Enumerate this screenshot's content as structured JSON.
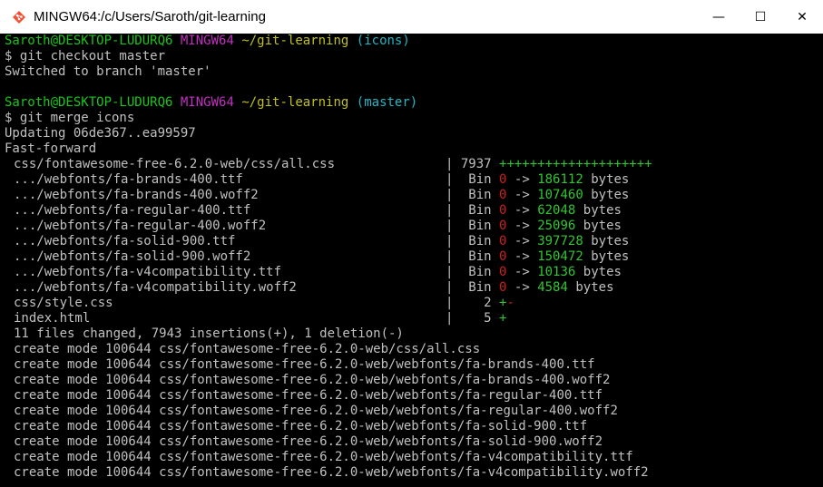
{
  "window": {
    "title": "MINGW64:/c/Users/Saroth/git-learning",
    "minimize": "—",
    "maximize": "☐",
    "close": "✕"
  },
  "colors": {
    "user": "#1bc31b",
    "system": "#c22fc2",
    "path": "#c1c11b",
    "branch": "#24b6c4",
    "deletion": "#cd2020",
    "insertion": "#31c531"
  },
  "prompt1": {
    "user": "Saroth@DESKTOP-LUDURQ6",
    "system": "MINGW64",
    "path": "~/git-learning",
    "branch": "(icons)"
  },
  "cmd1": "$ git checkout master",
  "out1": "Switched to branch 'master'",
  "prompt2": {
    "user": "Saroth@DESKTOP-LUDURQ6",
    "system": "MINGW64",
    "path": "~/git-learning",
    "branch": "(master)"
  },
  "cmd2": "$ git merge icons",
  "updating": "Updating 06de367..ea99597",
  "fastforward": "Fast-forward",
  "stats": [
    {
      "file": "css/fontawesome-free-6.2.0-web/css/all.css",
      "type": "text",
      "count": "7937",
      "plus": "++++++++++++++++++++",
      "minus": ""
    },
    {
      "file": ".../webfonts/fa-brands-400.ttf",
      "type": "bin",
      "bin": "Bin",
      "from": "0",
      "arrow": "->",
      "to": "186112",
      "unit": "bytes"
    },
    {
      "file": ".../webfonts/fa-brands-400.woff2",
      "type": "bin",
      "bin": "Bin",
      "from": "0",
      "arrow": "->",
      "to": "107460",
      "unit": "bytes"
    },
    {
      "file": ".../webfonts/fa-regular-400.ttf",
      "type": "bin",
      "bin": "Bin",
      "from": "0",
      "arrow": "->",
      "to": "62048",
      "unit": "bytes"
    },
    {
      "file": ".../webfonts/fa-regular-400.woff2",
      "type": "bin",
      "bin": "Bin",
      "from": "0",
      "arrow": "->",
      "to": "25096",
      "unit": "bytes"
    },
    {
      "file": ".../webfonts/fa-solid-900.ttf",
      "type": "bin",
      "bin": "Bin",
      "from": "0",
      "arrow": "->",
      "to": "397728",
      "unit": "bytes"
    },
    {
      "file": ".../webfonts/fa-solid-900.woff2",
      "type": "bin",
      "bin": "Bin",
      "from": "0",
      "arrow": "->",
      "to": "150472",
      "unit": "bytes"
    },
    {
      "file": ".../webfonts/fa-v4compatibility.ttf",
      "type": "bin",
      "bin": "Bin",
      "from": "0",
      "arrow": "->",
      "to": "10136",
      "unit": "bytes"
    },
    {
      "file": ".../webfonts/fa-v4compatibility.woff2",
      "type": "bin",
      "bin": "Bin",
      "from": "0",
      "arrow": "->",
      "to": "4584",
      "unit": "bytes"
    },
    {
      "file": "css/style.css",
      "type": "text",
      "count": "   2",
      "plus": "+",
      "minus": "-"
    },
    {
      "file": "index.html",
      "type": "text",
      "count": "   5",
      "plus": "+",
      "minus": ""
    }
  ],
  "summary": "11 files changed, 7943 insertions(+), 1 deletion(-)",
  "creates": [
    "create mode 100644 css/fontawesome-free-6.2.0-web/css/all.css",
    "create mode 100644 css/fontawesome-free-6.2.0-web/webfonts/fa-brands-400.ttf",
    "create mode 100644 css/fontawesome-free-6.2.0-web/webfonts/fa-brands-400.woff2",
    "create mode 100644 css/fontawesome-free-6.2.0-web/webfonts/fa-regular-400.ttf",
    "create mode 100644 css/fontawesome-free-6.2.0-web/webfonts/fa-regular-400.woff2",
    "create mode 100644 css/fontawesome-free-6.2.0-web/webfonts/fa-solid-900.ttf",
    "create mode 100644 css/fontawesome-free-6.2.0-web/webfonts/fa-solid-900.woff2",
    "create mode 100644 css/fontawesome-free-6.2.0-web/webfonts/fa-v4compatibility.ttf",
    "create mode 100644 css/fontawesome-free-6.2.0-web/webfonts/fa-v4compatibility.woff2"
  ]
}
